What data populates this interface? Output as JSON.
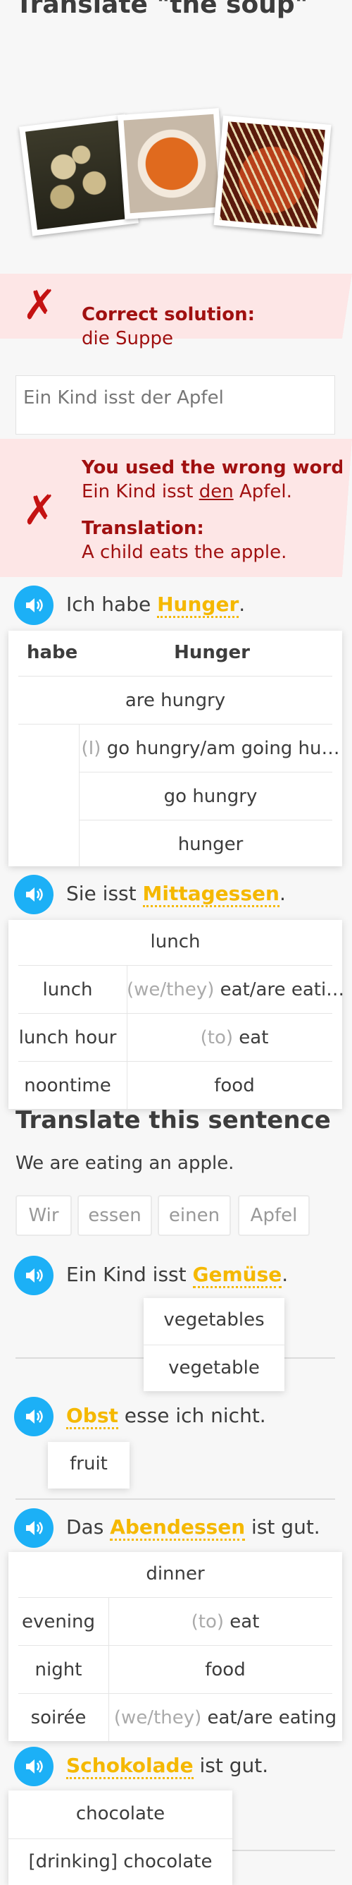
{
  "challenge1": {
    "title": "Translate \"the soup\""
  },
  "solution": {
    "label": "Correct solution:",
    "answer": "die Suppe"
  },
  "answer1": {
    "text": "Ein Kind isst der Apfel"
  },
  "feedback": {
    "heading": "You used the wrong word.",
    "sentence_prefix": "Ein Kind isst ",
    "sentence_word": "den",
    "sentence_suffix": " Apfel.",
    "translation_label": "Translation:",
    "translation": "A child eats the apple."
  },
  "s1": {
    "prefix": "Ich habe ",
    "word": "Hunger",
    "suffix": ".",
    "head_left": "habe",
    "head_right": "Hunger",
    "r1": "are hungry",
    "r2_gray": "(I)",
    "r2": " go hungry/am going hu…",
    "r3": "go hungry",
    "r4": "hunger"
  },
  "s2": {
    "prefix": "Sie isst ",
    "word": "Mittagessen",
    "suffix": ".",
    "top": "lunch",
    "r1_left": "lunch",
    "r1_gray": "(we/they)",
    "r1_right": " eat/are eati…",
    "r2_left": "lunch hour",
    "r2_gray": "(to)",
    "r2_right": " eat",
    "r3_left": "noontime",
    "r3_right": "food"
  },
  "challenge2": {
    "title": "Translate this sentence",
    "sentence": "We are eating an apple.",
    "chips": [
      "Wir",
      "essen",
      "einen",
      "Apfel"
    ]
  },
  "s3": {
    "prefix": "Ein Kind isst ",
    "word": "Gemüse",
    "suffix": ".",
    "h1": "vegetables",
    "h2": "vegetable"
  },
  "s4": {
    "word": "Obst",
    "suffix": " esse ich nicht.",
    "h1": "fruit"
  },
  "s5": {
    "prefix": "Das ",
    "word": "Abendessen",
    "suffix": " ist gut.",
    "top": "dinner",
    "r1_left": "evening",
    "r1_gray": "(to)",
    "r1_right": " eat",
    "r2_left": "night",
    "r2_right": "food",
    "r3_left": "soirée",
    "r3_gray": "(we/they)",
    "r3_right": " eat/are eating"
  },
  "s6": {
    "word": "Schokolade",
    "suffix": " ist gut.",
    "h1": "chocolate",
    "h2": "[drinking] chocolate"
  },
  "colors": {
    "accent_blue": "#1cb0f6",
    "highlight": "#f5b800",
    "error": "#a01010",
    "error_bg": "#fde6e6"
  },
  "icons": {
    "speaker": "speaker-icon",
    "wrong": "x-icon"
  }
}
